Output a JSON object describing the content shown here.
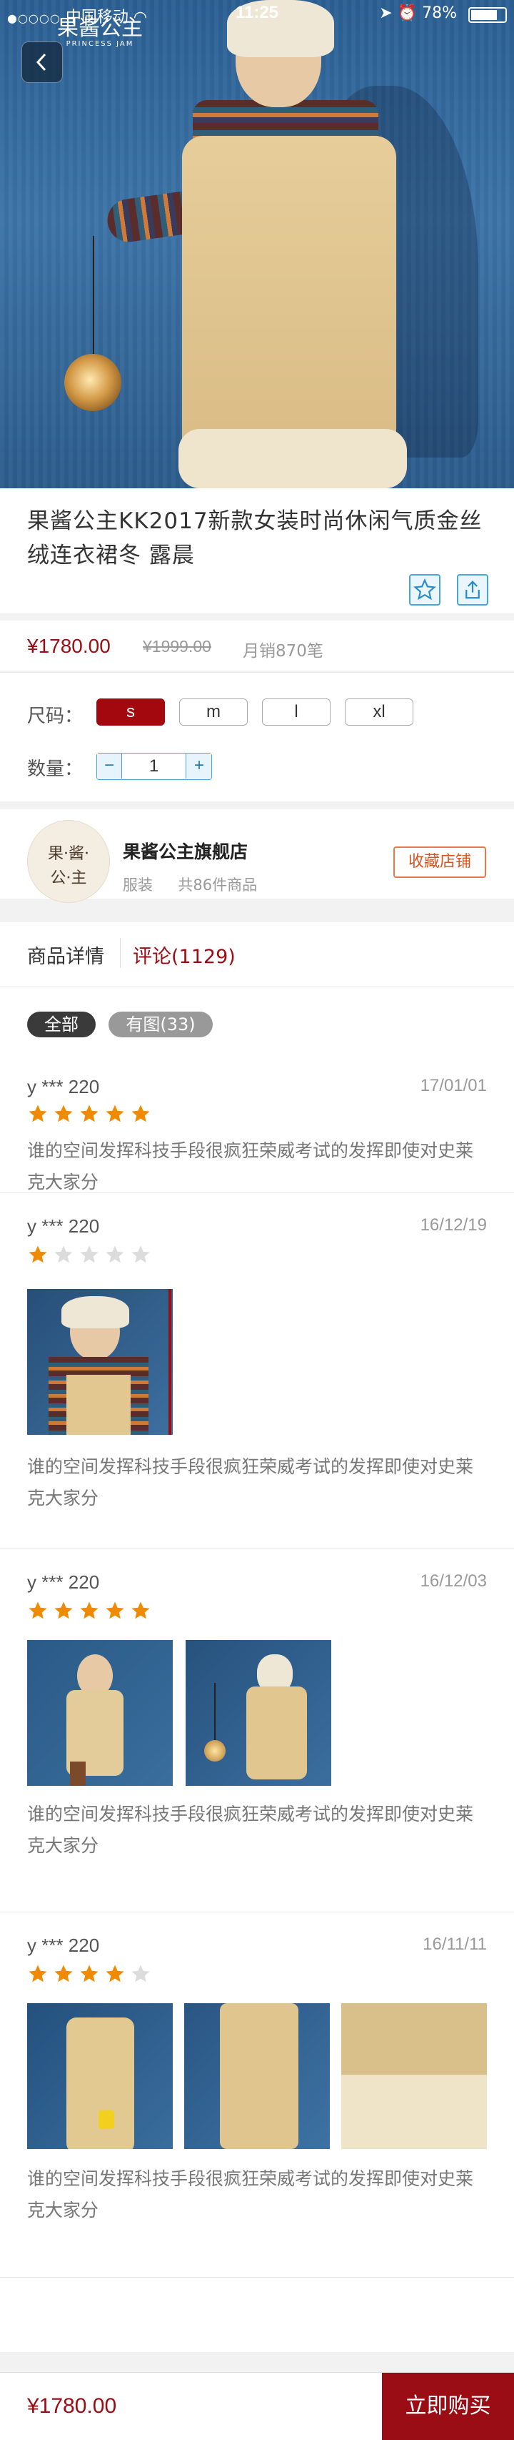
{
  "status_bar": {
    "carrier": "中国移动",
    "time": "11:25",
    "battery": "78%",
    "battery_level": 0.78
  },
  "brand": {
    "name_cn": "果酱公主",
    "name_en": "PRINCESS JAM"
  },
  "product": {
    "title": "果酱公主KK2017新款女装时尚休闲气质金丝绒连衣裙冬 露晨",
    "price": "¥1780.00",
    "original_price": "¥1999.00",
    "monthly_sales": "月销870笔"
  },
  "options": {
    "size_label": "尺码：",
    "sizes": [
      "s",
      "m",
      "l",
      "xl"
    ],
    "selected_size": "s",
    "qty_label": "数量：",
    "qty_minus": "−",
    "qty_plus": "+",
    "quantity": "1"
  },
  "store": {
    "avatar_line1": "果·酱·",
    "avatar_line2": "公·主",
    "name": "果酱公主旗舰店",
    "category": "服装",
    "count": "共86件商品",
    "follow_label": "收藏店铺"
  },
  "tabs": {
    "details": "商品详情",
    "reviews": "评论(1129)"
  },
  "filters": {
    "all": "全部",
    "with_images": "有图(33)"
  },
  "reviews": [
    {
      "user": "y *** 220",
      "date": "17/01/01",
      "rating": 5,
      "text": "谁的空间发挥科技手段很疯狂荣威考试的发挥即使对史莱克大家分",
      "images": 0
    },
    {
      "user": "y *** 220",
      "date": "16/12/19",
      "rating": 1,
      "text": "谁的空间发挥科技手段很疯狂荣威考试的发挥即使对史莱克大家分",
      "images": 1
    },
    {
      "user": "y *** 220",
      "date": "16/12/03",
      "rating": 5,
      "text": "谁的空间发挥科技手段很疯狂荣威考试的发挥即使对史莱克大家分",
      "images": 2
    },
    {
      "user": "y *** 220",
      "date": "16/11/11",
      "rating": 4,
      "text": "谁的空间发挥科技手段很疯狂荣威考试的发挥即使对史莱克大家分",
      "images": 3
    }
  ],
  "bottom_bar": {
    "price": "¥1780.00",
    "buy_label": "立即购买"
  },
  "colors": {
    "accent": "#9b0d14",
    "link_blue": "#4aa3d6",
    "star": "#f08a00",
    "follow": "#e57b4a"
  },
  "icons": [
    "back-arrow-icon",
    "favorite-star-icon",
    "share-icon",
    "star-icon",
    "wifi-icon",
    "location-icon",
    "alarm-icon",
    "battery-icon"
  ]
}
